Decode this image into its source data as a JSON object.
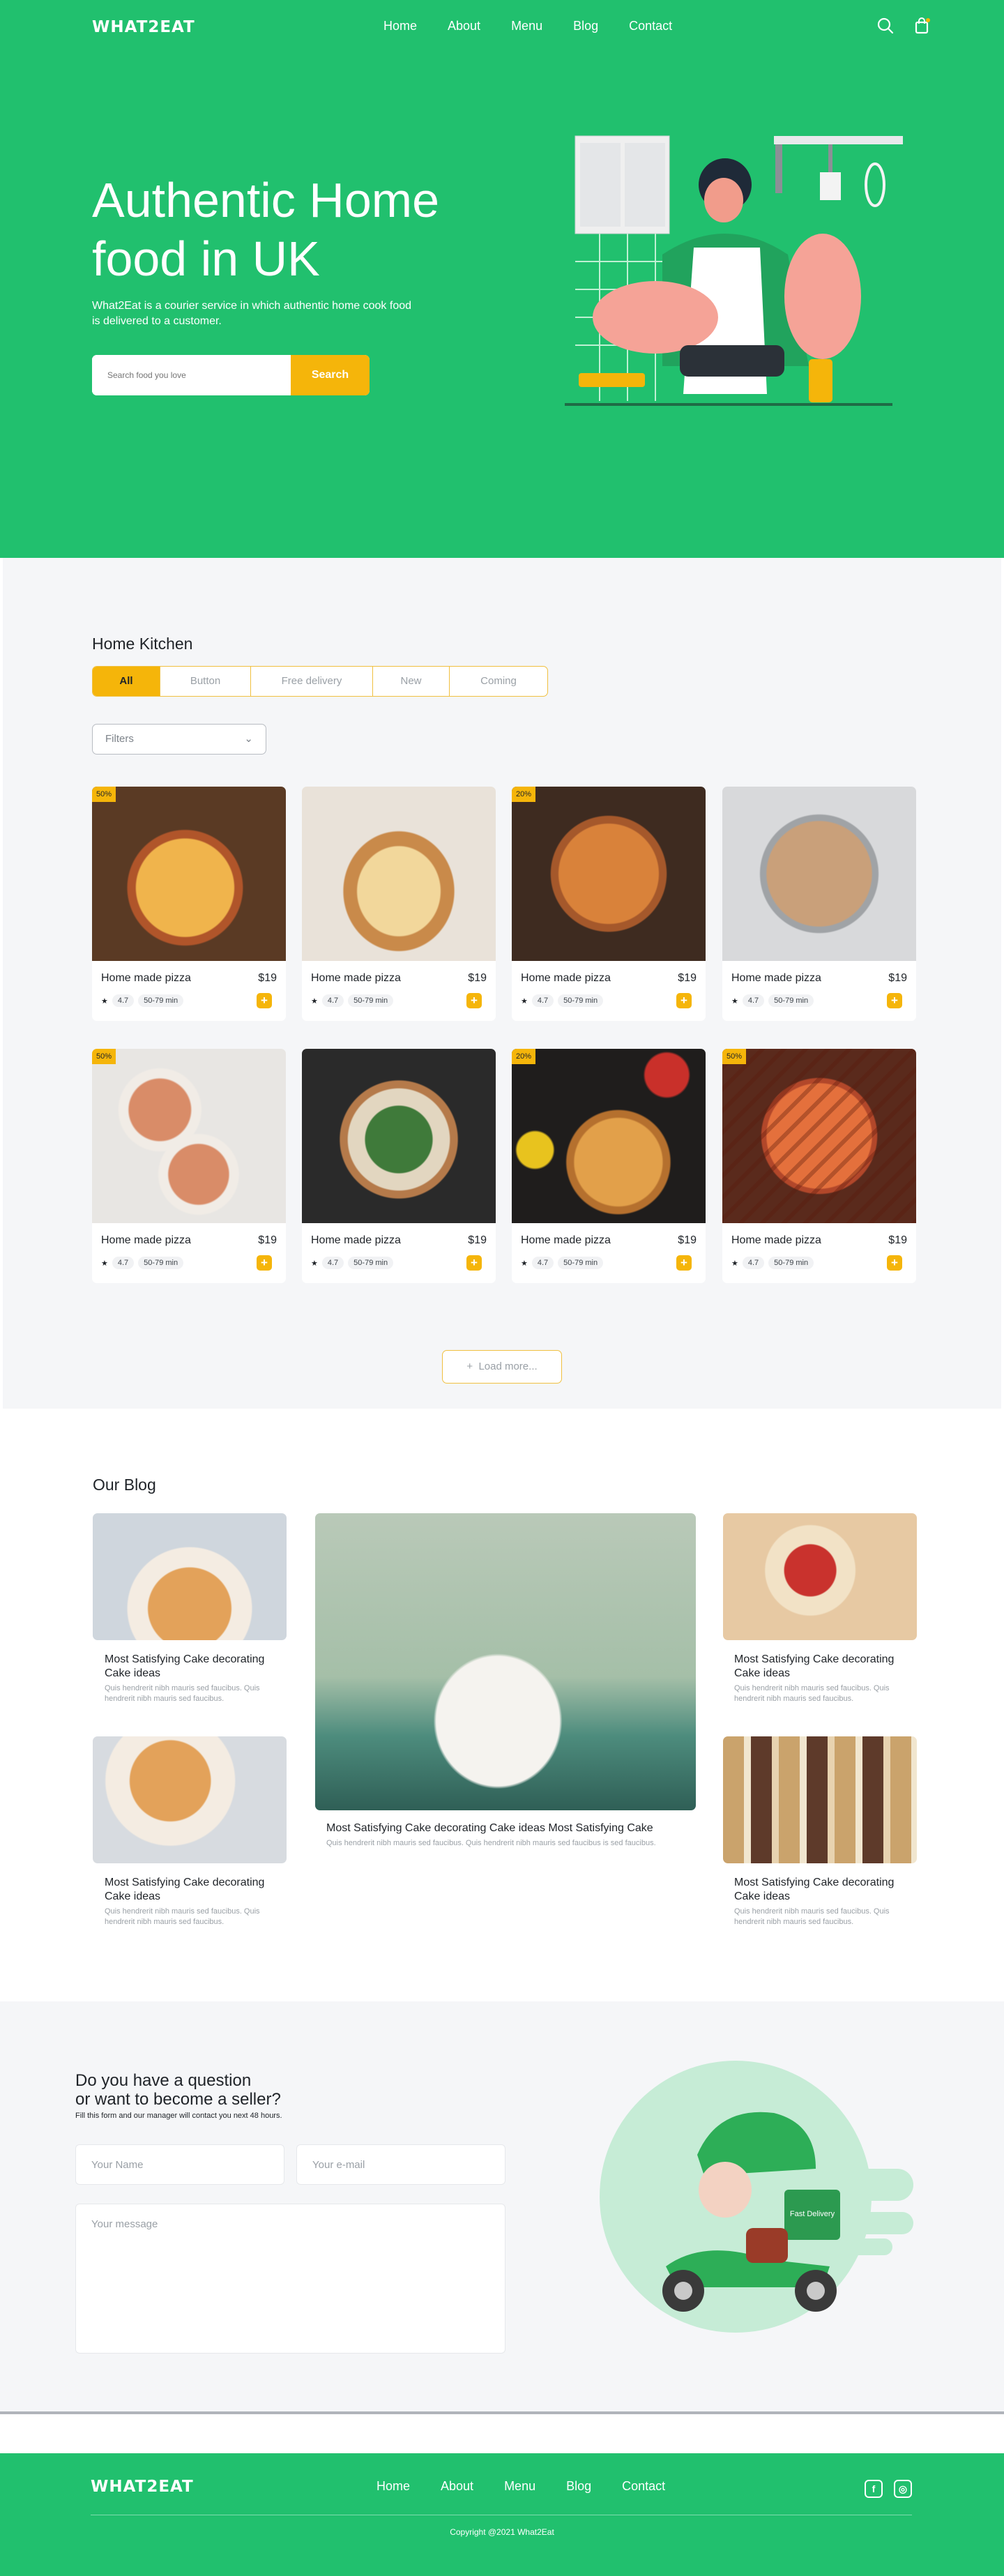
{
  "brand": "WHAT2EAT",
  "nav": [
    "Home",
    "About",
    "Menu",
    "Blog",
    "Contact"
  ],
  "hero": {
    "title": "Authentic Home food in UK",
    "description": "What2Eat is a courier service in which authentic home cook food is delivered to a customer.",
    "search_placeholder": "Search food you love",
    "search_button": "Search"
  },
  "kitchen": {
    "title": "Home Kitchen",
    "tabs": [
      "All",
      "Button",
      "Free delivery",
      "New",
      "Coming"
    ],
    "active_tab": "All",
    "filters_label": "Filters",
    "load_more": "Load more...",
    "cards": [
      {
        "name": "Home made pizza",
        "price": "$19",
        "rating": "4.7",
        "time": "50-79 min",
        "badge": "50%"
      },
      {
        "name": "Home made pizza",
        "price": "$19",
        "rating": "4.7",
        "time": "50-79 min",
        "badge": ""
      },
      {
        "name": "Home made pizza",
        "price": "$19",
        "rating": "4.7",
        "time": "50-79 min",
        "badge": "20%"
      },
      {
        "name": "Home made pizza",
        "price": "$19",
        "rating": "4.7",
        "time": "50-79 min",
        "badge": ""
      },
      {
        "name": "Home made pizza",
        "price": "$19",
        "rating": "4.7",
        "time": "50-79 min",
        "badge": "50%"
      },
      {
        "name": "Home made pizza",
        "price": "$19",
        "rating": "4.7",
        "time": "50-79 min",
        "badge": ""
      },
      {
        "name": "Home made pizza",
        "price": "$19",
        "rating": "4.7",
        "time": "50-79 min",
        "badge": "20%"
      },
      {
        "name": "Home made pizza",
        "price": "$19",
        "rating": "4.7",
        "time": "50-79 min",
        "badge": "50%"
      }
    ]
  },
  "blog": {
    "title": "Our Blog",
    "posts": [
      {
        "title": "Most Satisfying Cake decorating Cake ideas",
        "text": "Quis hendrerit nibh mauris sed faucibus. Quis hendrerit nibh mauris sed faucibus."
      },
      {
        "title": "Most Satisfying Cake decorating Cake ideas Most Satisfying Cake",
        "text": "Quis hendrerit nibh mauris sed faucibus. Quis hendrerit nibh mauris sed faucibus is sed faucibus."
      },
      {
        "title": "Most Satisfying Cake decorating Cake ideas",
        "text": "Quis hendrerit nibh mauris sed faucibus. Quis hendrerit nibh mauris sed faucibus."
      },
      {
        "title": "Most Satisfying Cake decorating Cake ideas",
        "text": "Quis hendrerit nibh mauris sed faucibus. Quis hendrerit nibh mauris sed faucibus."
      },
      {
        "title": "Most Satisfying Cake decorating Cake ideas",
        "text": "Quis hendrerit nibh mauris sed faucibus. Quis hendrerit nibh mauris sed faucibus."
      }
    ]
  },
  "contact": {
    "title_line1": "Do you have a question",
    "title_line2": "or want to become a seller?",
    "subtitle": "Fill this form and our manager will contact you next 48 hours.",
    "name_placeholder": "Your Name",
    "email_placeholder": "Your e-mail",
    "message_placeholder": "Your message",
    "scooter_text": "Fast Delivery"
  },
  "footer": {
    "copyright": "Copyright @2021 What2Eat"
  },
  "colors": {
    "brand_green": "#21c06e",
    "accent_yellow": "#f5b50a"
  }
}
